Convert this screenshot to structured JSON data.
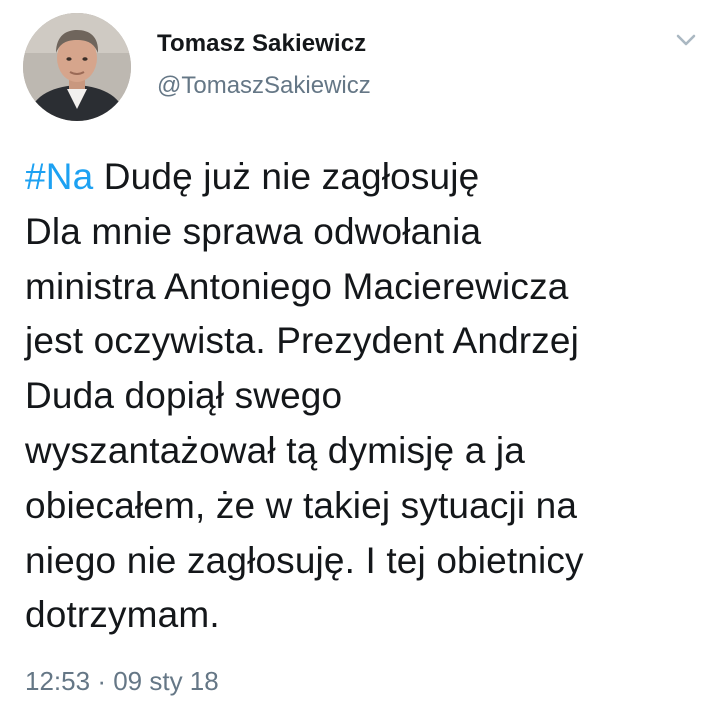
{
  "author": {
    "display_name": "Tomasz Sakiewicz",
    "handle": "@TomaszSakiewicz",
    "avatar_icon": "profile-photo"
  },
  "menu": {
    "caret_icon": "chevron-down-icon"
  },
  "tweet": {
    "hashtag": "#Na",
    "lines": [
      " Dudę już nie zagłosuję",
      "Dla mnie sprawa odwołania",
      "ministra Antoniego Macierewicza",
      "jest oczywista. Prezydent Andrzej",
      "Duda dopiął swego",
      "wyszantażował tą dymisję a ja",
      "obiecałem, że w takiej sytuacji na",
      "niego nie zagłosuję. I tej obietnicy",
      "dotrzymam."
    ]
  },
  "meta": {
    "time": "12:53",
    "separator": "·",
    "date": "09 sty 18"
  },
  "colors": {
    "text": "#14171a",
    "secondary": "#657786",
    "link": "#1da1f2",
    "background": "#ffffff"
  }
}
